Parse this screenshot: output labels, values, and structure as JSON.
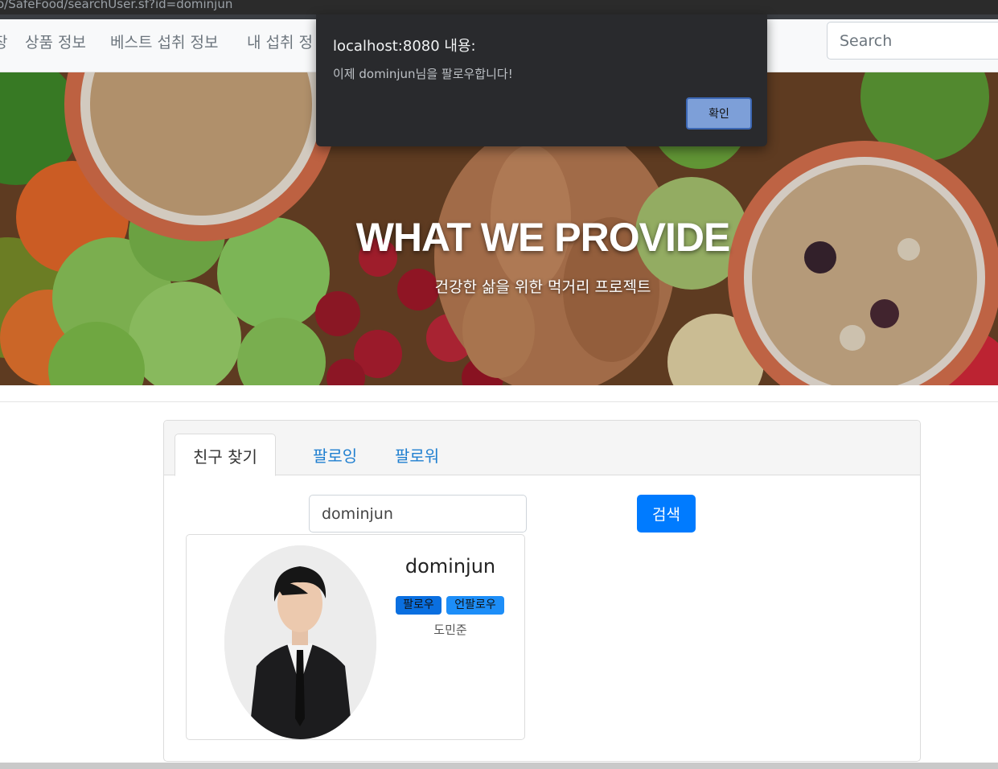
{
  "browser": {
    "url_fragment": "o/SafeFood/searchUser.sf?id=dominjun"
  },
  "nav": {
    "items": [
      "장",
      "상품 정보",
      "베스트 섭취 정보",
      "내 섭취 정"
    ],
    "search_placeholder": "Search"
  },
  "hero": {
    "title": "WHAT WE PROVIDE",
    "subtitle": "건강한 삶을 위한 먹거리 프로젝트"
  },
  "tabs": [
    {
      "label": "친구 찾기",
      "active": true
    },
    {
      "label": "팔로잉",
      "active": false
    },
    {
      "label": "팔로워",
      "active": false
    }
  ],
  "search": {
    "value": "dominjun",
    "button_label": "검색"
  },
  "user": {
    "id": "dominjun",
    "follow_label": "팔로우",
    "unfollow_label": "언팔로우",
    "name": "도민준"
  },
  "dialog": {
    "title": "localhost:8080 내용:",
    "message": "이제 dominjun님을 팔로우합니다!",
    "ok_label": "확인"
  },
  "colors": {
    "primary": "#007bff",
    "link": "#1f7fd0",
    "dialog_bg": "#292a2d",
    "dialog_button": "#7d9fd8"
  }
}
